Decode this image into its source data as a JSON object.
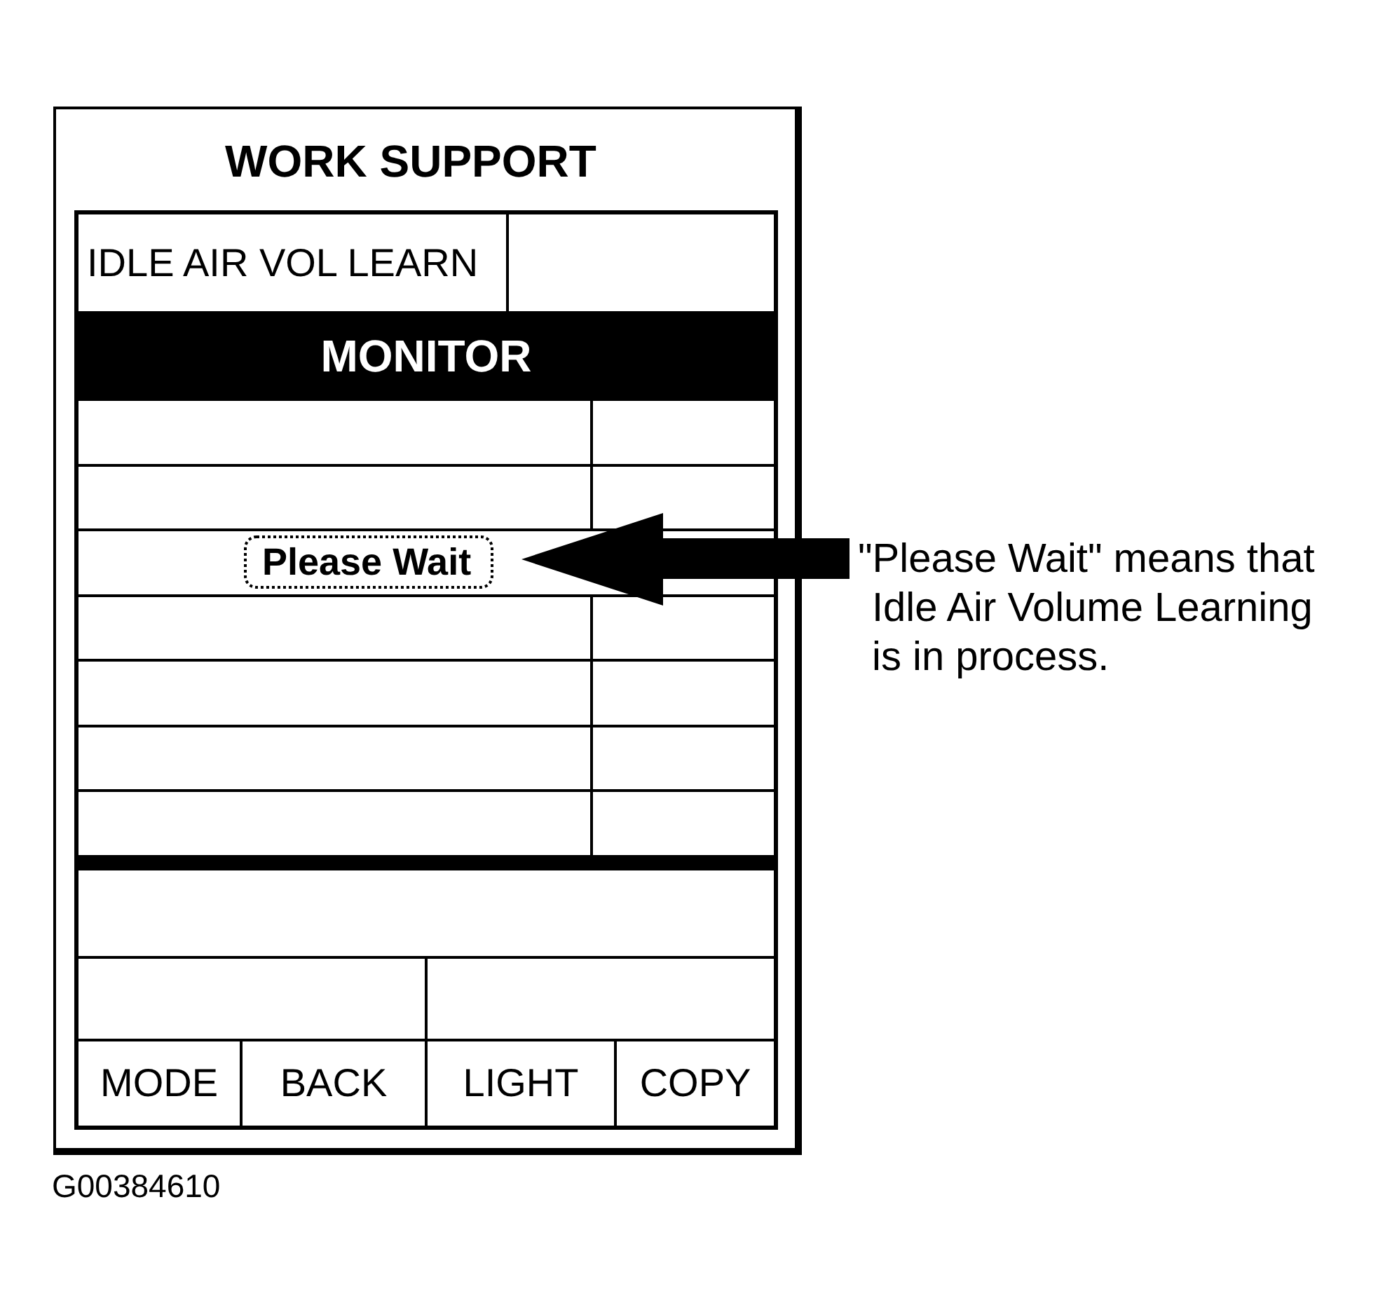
{
  "device": {
    "title": "WORK SUPPORT",
    "function_label": "IDLE AIR VOL LEARN",
    "monitor": {
      "heading": "MONITOR",
      "rows": [
        {
          "kind": "blank"
        },
        {
          "kind": "blank"
        },
        {
          "kind": "message",
          "text": "Please Wait"
        },
        {
          "kind": "blank"
        },
        {
          "kind": "blank"
        },
        {
          "kind": "blank"
        },
        {
          "kind": "blank"
        }
      ]
    },
    "soft_keys": [
      "MODE",
      "BACK",
      "LIGHT",
      "COPY"
    ]
  },
  "callout": {
    "text": "\"Please Wait\" means that Idle Air Volume Learning is in process."
  },
  "figure_code": "G00384610"
}
